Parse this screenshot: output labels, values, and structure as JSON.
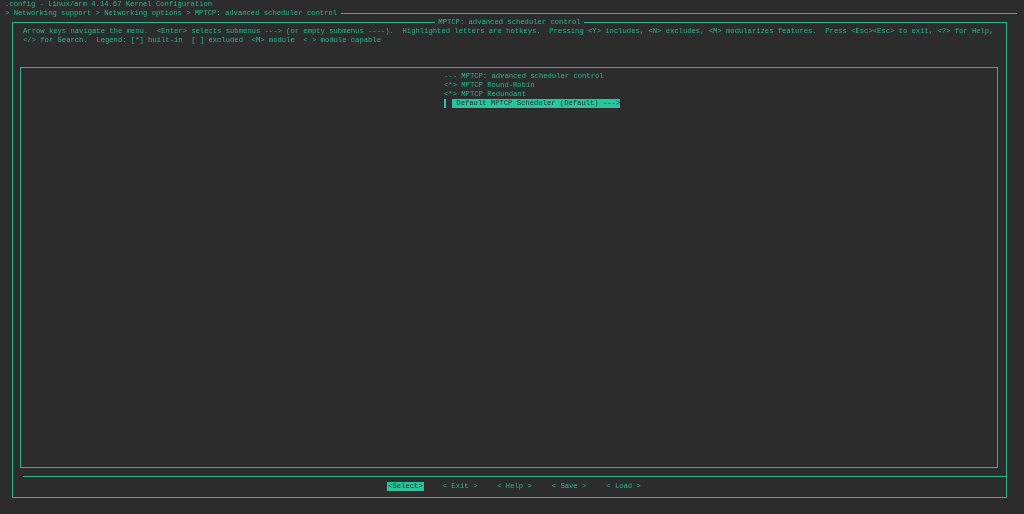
{
  "window": {
    "title": ".config - Linux/arm 4.14.67 Kernel Configuration"
  },
  "breadcrumb": "> Networking support > Networking options > MPTCP: advanced scheduler control",
  "dialog": {
    "title": "MPTCP: advanced scheduler control",
    "help_lines": [
      "Arrow keys navigate the menu.  <Enter> selects submenus ---> (or empty submenus ----).  Highlighted letters are hotkeys.  Pressing <Y> includes, <N> excludes, <M> modularizes features.  Press <Esc><Esc> to exit, <?> for Help,",
      "</> for Search.  Legend: [*] built-in  [ ] excluded  <M> module  < > module capable"
    ],
    "menu": [
      {
        "kind": "comment",
        "prefix": "---",
        "label": "MPTCP: advanced scheduler control",
        "selected": false
      },
      {
        "kind": "option",
        "prefix": "<*>",
        "label": "MPTCP Round-Robin",
        "selected": false
      },
      {
        "kind": "option",
        "prefix": "<*>",
        "label": "MPTCP Redundant",
        "selected": false
      },
      {
        "kind": "submenu",
        "label": "Default MPTCP Scheduler (Default)",
        "suffix": "--->",
        "selected": true
      }
    ],
    "buttons": [
      {
        "label": "<Select>",
        "selected": true
      },
      {
        "label": "< Exit >",
        "selected": false
      },
      {
        "label": "< Help >",
        "selected": false
      },
      {
        "label": "< Save >",
        "selected": false
      },
      {
        "label": "< Load >",
        "selected": false
      }
    ]
  }
}
